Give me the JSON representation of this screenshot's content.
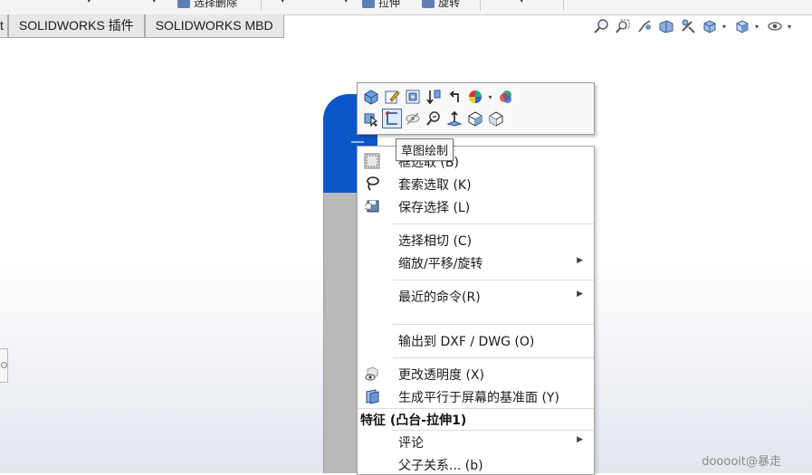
{
  "ribbon": {
    "partial_button": "选择删除",
    "partial_button2": "拉伸",
    "partial_button3": "旋转"
  },
  "tabs": [
    "t",
    "SOLIDWORKS 插件",
    "SOLIDWORKS MBD"
  ],
  "hud_icons": [
    "zoom-to-fit-icon",
    "zoom-area-icon",
    "previous-view-icon",
    "section-view-icon",
    "dynamic-annotation-icon",
    "view-orientation-icon",
    "display-style-icon",
    "hide-show-icon"
  ],
  "toolbar": {
    "row1": [
      "appearance-icon",
      "edit-sketch-icon",
      "edit-feature-icon",
      "rollback-icon",
      "parent-icon",
      "appearance-color-icon",
      "render-icon"
    ],
    "row2": [
      "select-other-icon",
      "sketch-icon",
      "hide-icon",
      "zoom-selection-icon",
      "normal-to-icon",
      "isometric-icon",
      "view-cube-icon"
    ],
    "tooltip": "草图绘制"
  },
  "menu": {
    "items": [
      {
        "label": "框选取 (B)",
        "icon": "box-select-icon"
      },
      {
        "label": "套索选取 (K)",
        "icon": "lasso-select-icon"
      },
      {
        "label": "保存选择 (L)",
        "icon": "save-selection-icon"
      },
      {
        "label": "选择相切 (C)",
        "icon": ""
      },
      {
        "label": "缩放/平移/旋转",
        "icon": "",
        "submenu": true
      },
      {
        "label": "最近的命令(R)",
        "icon": "",
        "submenu": true
      },
      {
        "label": "输出到 DXF / DWG (O)",
        "icon": ""
      },
      {
        "label": "更改透明度 (X)",
        "icon": "transparency-icon"
      },
      {
        "label": "生成平行于屏幕的基准面 (Y)",
        "icon": "plane-icon"
      }
    ],
    "section_header": "特征 (凸台-拉伸1)",
    "section_items": [
      {
        "label": "评论",
        "submenu": true
      },
      {
        "label": "父子关系... (b)"
      }
    ]
  },
  "watermark": "dooooit@暴走"
}
